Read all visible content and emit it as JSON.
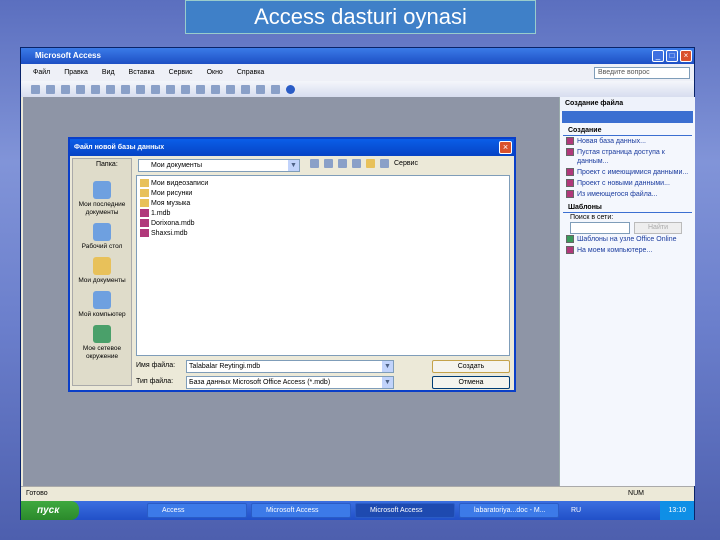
{
  "slide_title": "Access dasturi oynasi",
  "window": {
    "title": "Microsoft Access",
    "menu": [
      "Файл",
      "Правка",
      "Вид",
      "Вставка",
      "Сервис",
      "Окно",
      "Справка"
    ],
    "ask_placeholder": "Введите вопрос"
  },
  "task_pane": {
    "title": "Создание файла",
    "create_header": "Создание",
    "create_links": [
      "Новая база данных...",
      "Пустая страница доступа к данным...",
      "Проект с имеющимися данными...",
      "Проект с новыми данными...",
      "Из имеющегося файла..."
    ],
    "templates_header": "Шаблоны",
    "search_label": "Поиск в сети:",
    "search_button": "Найти",
    "template_links": [
      "Шаблоны на узле Office Online",
      "На моем компьютере..."
    ]
  },
  "dialog": {
    "title": "Файл новой базы данных",
    "look_in_label": "Папка:",
    "look_in_value": "Мои документы",
    "service_label": "Сервис",
    "places": [
      "Мои последние документы",
      "Рабочий стол",
      "Мои документы",
      "Мой компьютер",
      "Мое сетевое окружение"
    ],
    "files": [
      {
        "name": "Мои видеозаписи",
        "type": "folder"
      },
      {
        "name": "Мои рисунки",
        "type": "folder"
      },
      {
        "name": "Моя музыка",
        "type": "folder"
      },
      {
        "name": "1.mdb",
        "type": "db"
      },
      {
        "name": "Dorixona.mdb",
        "type": "db"
      },
      {
        "name": "Shaxsi.mdb",
        "type": "db"
      }
    ],
    "filename_label": "Имя файла:",
    "filename_value": "Talabalar Reytingi.mdb",
    "filetype_label": "Тип файла:",
    "filetype_value": "База данных Microsoft Office Access (*.mdb)",
    "create_button": "Создать",
    "cancel_button": "Отмена"
  },
  "status": {
    "text": "Готово",
    "num": "NUM"
  },
  "taskbar": {
    "start": "пуск",
    "tasks": [
      "Access",
      "Microsoft Access",
      "Microsoft Access",
      "labaratoriya...doc - M..."
    ],
    "lang": "RU",
    "clock": "13:10"
  }
}
